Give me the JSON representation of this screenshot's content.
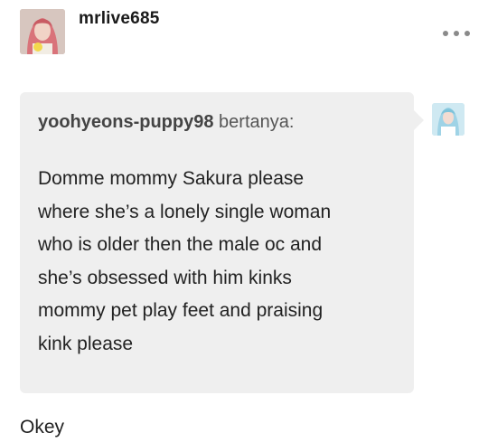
{
  "post": {
    "author": {
      "username": "mrlive685",
      "avatar_icon": "user-avatar-photo"
    },
    "menu_icon": "more-options-icon",
    "ask": {
      "asker_username": "yoohyeons-puppy98",
      "asked_label": "bertanya:",
      "asker_avatar_icon": "asker-avatar-photo",
      "question_lines": [
        "Domme mommy Sakura please",
        "where she’s a lonely single woman",
        "who is older then the male oc and",
        "she’s obsessed with him kinks",
        "mommy pet play feet and praising",
        "kink please"
      ]
    },
    "answer": "Okey"
  },
  "colors": {
    "ask_background": "#efefef",
    "text": "#222222",
    "muted": "#8a8a8a"
  }
}
